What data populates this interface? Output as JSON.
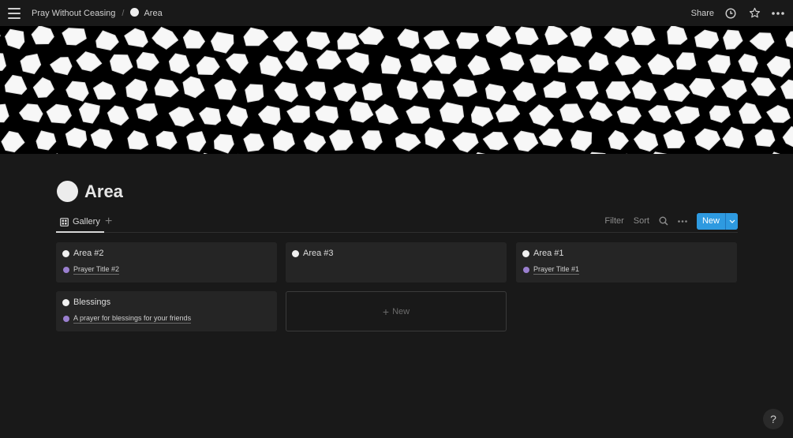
{
  "breadcrumb": {
    "workspace": "Pray Without Ceasing",
    "separator": "/",
    "page": "Area"
  },
  "topbar": {
    "share_label": "Share",
    "icons": [
      "menu-icon",
      "clock-icon",
      "star-icon",
      "more-icon"
    ]
  },
  "page": {
    "title": "Area",
    "icon": "white-circle-icon"
  },
  "views": {
    "active_tab": "Gallery",
    "add_view": "+",
    "filter_label": "Filter",
    "sort_label": "Sort",
    "new_label": "New"
  },
  "cards": [
    {
      "title": "Area #2",
      "property": "Prayer Title #2"
    },
    {
      "title": "Area #3",
      "property": ""
    },
    {
      "title": "Area #1",
      "property": "Prayer Title #1"
    },
    {
      "title": "Blessings",
      "property": "A prayer for blessings for your friends"
    }
  ],
  "new_card": {
    "plus": "+",
    "label": "New"
  },
  "help_label": "?",
  "colors": {
    "background": "#191919",
    "card": "#252525",
    "accent": "#2e9ae0",
    "property_dot": "#9a7fcf"
  }
}
